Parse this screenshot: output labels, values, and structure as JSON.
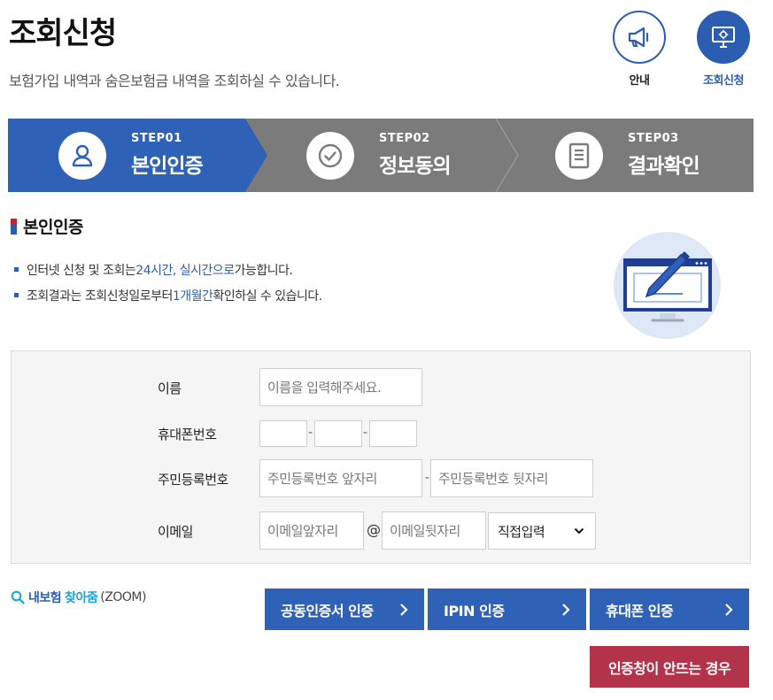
{
  "header": {
    "title": "조회신청",
    "description": "보험가입 내역과 숨은보험금 내역을 조회하실 수 있습니다.",
    "guide_label": "안내",
    "apply_label": "조회신청"
  },
  "steps": [
    {
      "num": "STEP01",
      "name": "본인인증",
      "icon": "user-icon",
      "active": true
    },
    {
      "num": "STEP02",
      "name": "정보동의",
      "icon": "check-circle-icon",
      "active": false
    },
    {
      "num": "STEP03",
      "name": "결과확인",
      "icon": "document-icon",
      "active": false
    }
  ],
  "section": {
    "title": "본인인증",
    "note1": {
      "a": "인터넷 신청 및 조회는 ",
      "hl": "24시간, 실시간으로",
      "b": " 가능합니다."
    },
    "note2": {
      "a": "조회결과는 조회신청일로부터 ",
      "hl": "1개월간",
      "b": " 확인하실 수 있습니다."
    }
  },
  "form": {
    "name_label": "이름",
    "name_placeholder": "이름을 입력해주세요.",
    "phone_label": "휴대폰번호",
    "phone_dash": "-",
    "rrn_label": "주민등록번호",
    "rrn_front_placeholder": "주민등록번호 앞자리",
    "rrn_back_placeholder": "주민등록번호 뒷자리",
    "email_label": "이메일",
    "email_id_placeholder": "이메일앞자리",
    "email_at": "@",
    "email_domain_placeholder": "이메일뒷자리",
    "email_select_value": "직접입력"
  },
  "zoom_link": {
    "a": "내보험",
    "b": "찾아줌",
    "c": "(ZOOM)"
  },
  "buttons": {
    "cert": "공동인증서 인증",
    "ipin": "IPIN 인증",
    "phone": "휴대폰 인증",
    "noauth": "인증창이 안뜨는 경우"
  },
  "colors": {
    "primary": "#2f62b6",
    "inactive_step": "#7b7b7b",
    "danger": "#b3344a"
  }
}
